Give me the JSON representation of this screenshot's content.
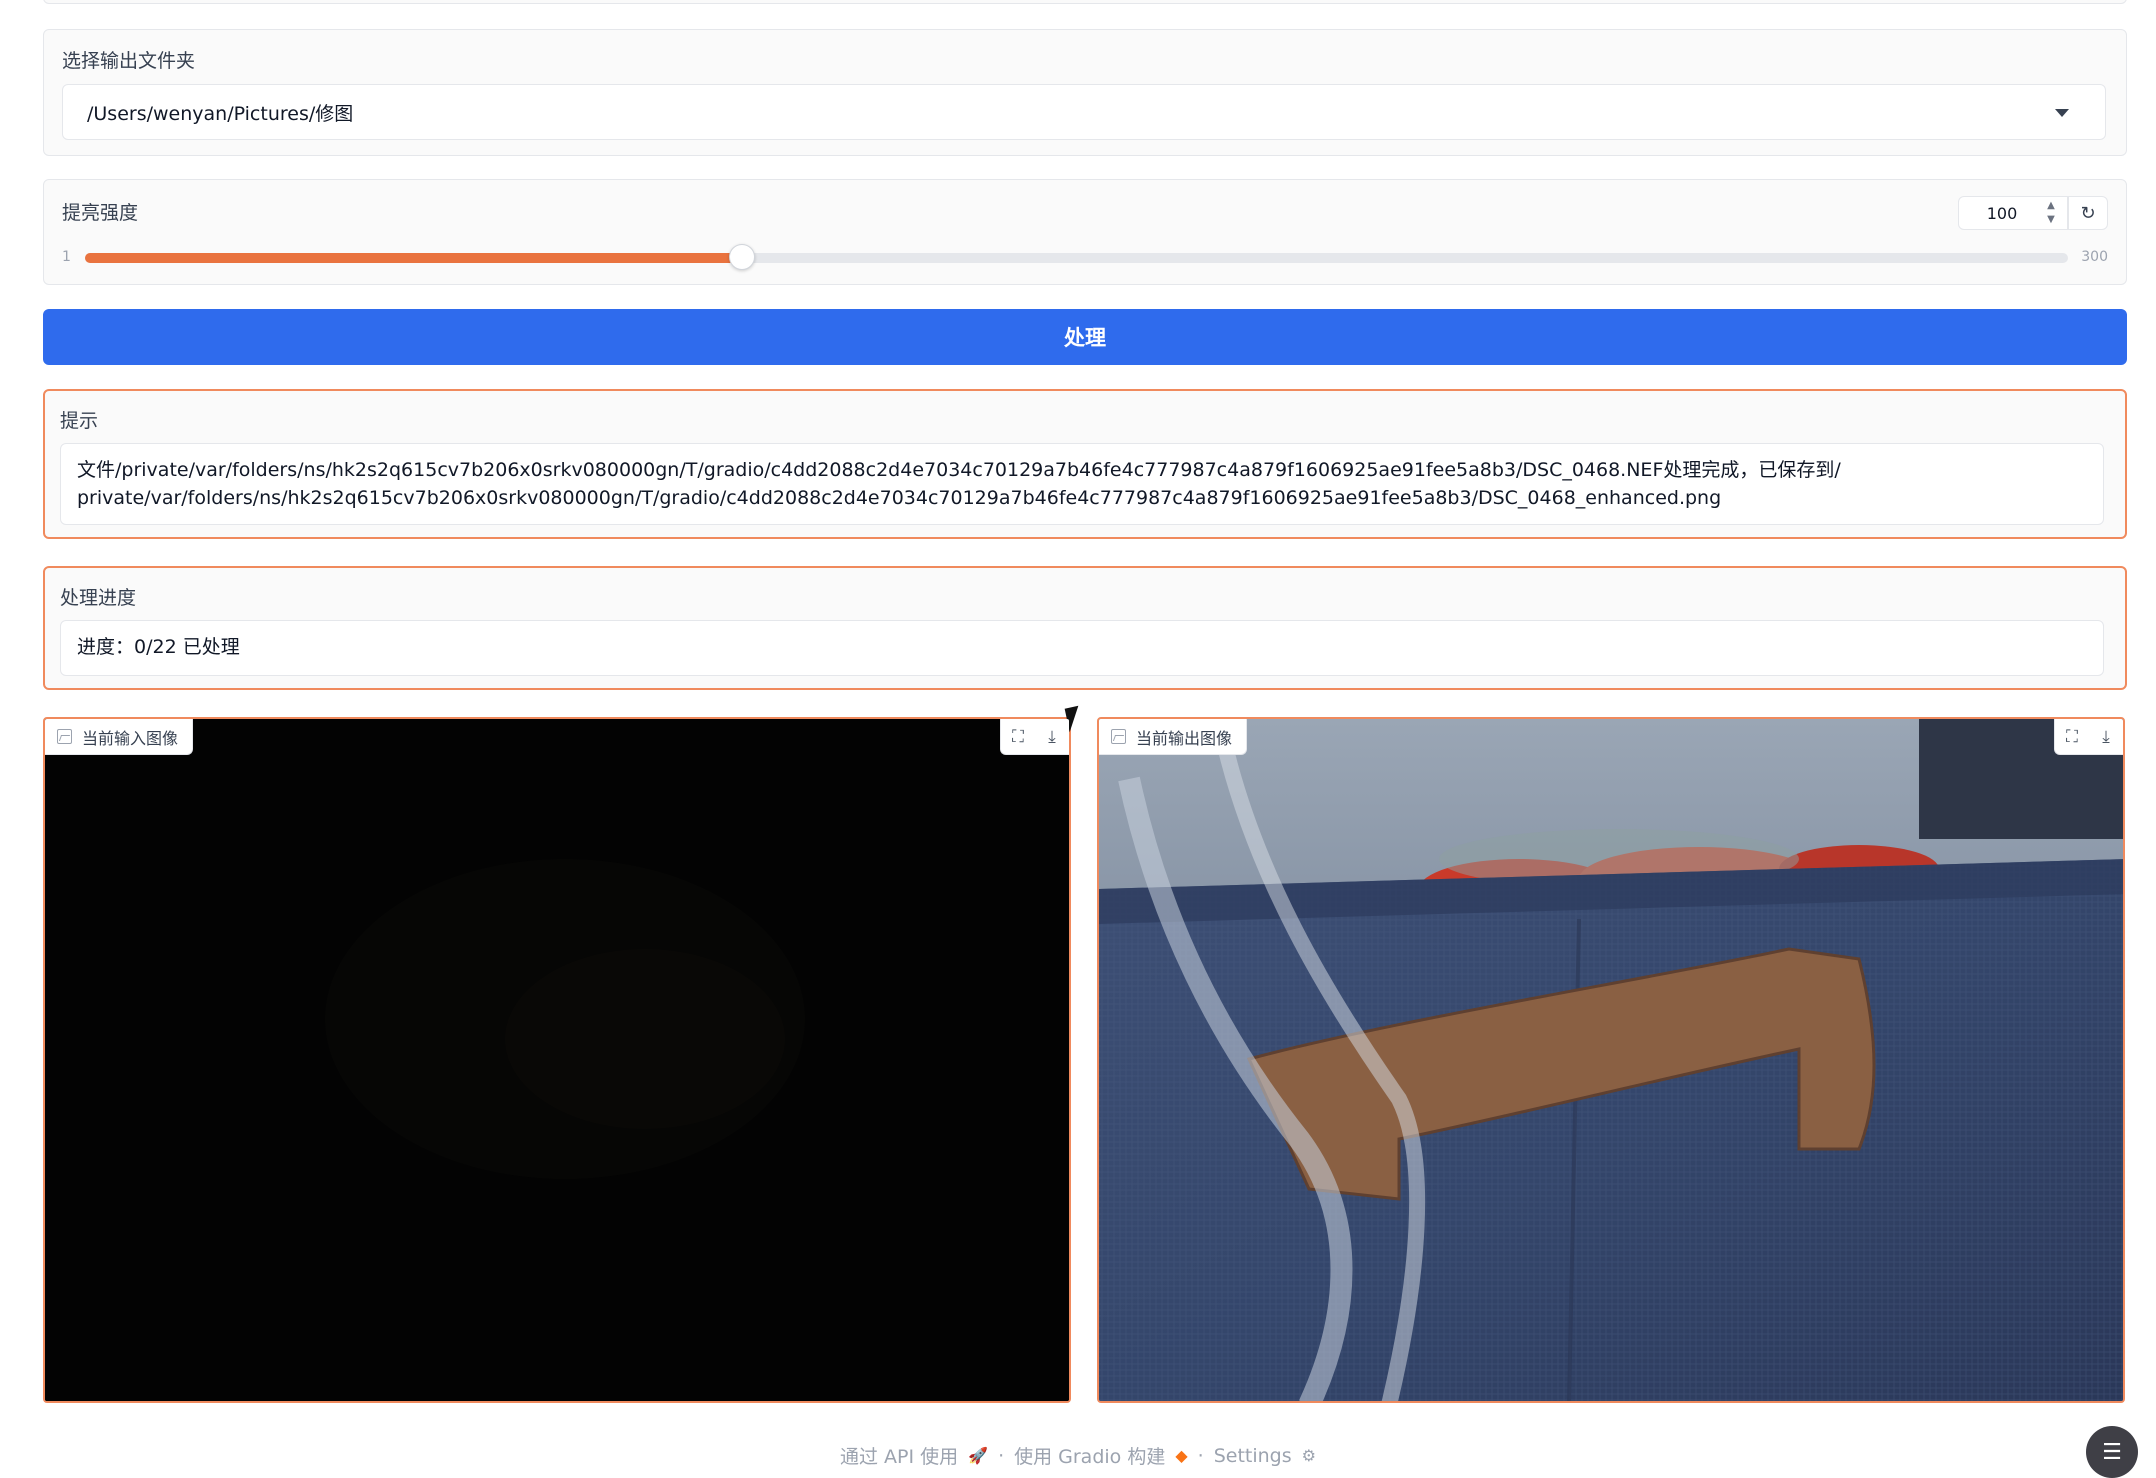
{
  "output_folder": {
    "label": "选择输出文件夹",
    "selected": "/Users/wenyan/Pictures/修图"
  },
  "brightness": {
    "label": "提亮强度",
    "value": "100",
    "min_label": "1",
    "max_label": "300",
    "min": 1,
    "max": 300,
    "current": 100,
    "reset_icon": "reset-icon"
  },
  "process_button": {
    "label": "处理"
  },
  "hint": {
    "label": "提示",
    "text": "文件/private/var/folders/ns/hk2s2q615cv7b206x0srkv080000gn/T/gradio/c4dd2088c2d4e7034c70129a7b46fe4c777987c4a879f1606925ae91fee5a8b3/DSC_0468.NEF处理完成，已保存到/\nprivate/var/folders/ns/hk2s2q615cv7b206x0srkv080000gn/T/gradio/c4dd2088c2d4e7034c70129a7b46fe4c777987c4a879f1606925ae91fee5a8b3/DSC_0468_enhanced.png"
  },
  "progress": {
    "label": "处理进度",
    "text": "进度：0/22 已处理"
  },
  "input_image": {
    "label": "当前输入图像"
  },
  "output_image": {
    "label": "当前输出图像"
  },
  "footer": {
    "api": "通过 API 使用",
    "built_with": "使用 Gradio 构建",
    "settings": "Settings"
  },
  "colors": {
    "accent": "#e9733f",
    "primary": "#2f6bed",
    "pending_border": "#f08a5d"
  }
}
